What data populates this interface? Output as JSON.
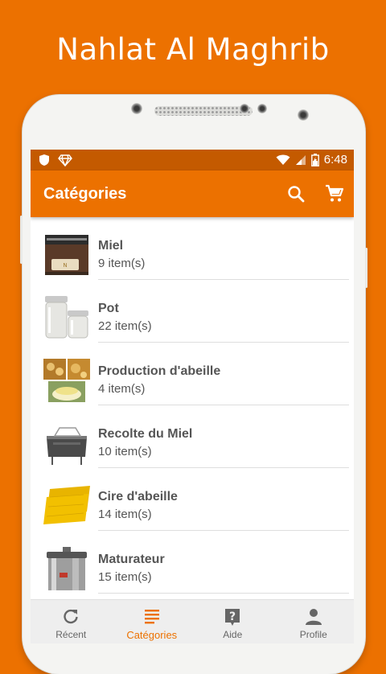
{
  "promo": {
    "title": "Nahlat Al Maghrib"
  },
  "status_bar": {
    "time": "6:48",
    "icons": [
      "shield-icon",
      "diamond-icon",
      "wifi-icon",
      "signal-icon",
      "battery-icon"
    ]
  },
  "app_bar": {
    "title": "Catégories",
    "actions": [
      "search-icon",
      "cart-icon"
    ]
  },
  "categories": [
    {
      "name": "Miel",
      "count": "9 item(s)"
    },
    {
      "name": "Pot",
      "count": "22 item(s)"
    },
    {
      "name": "Production d'abeille",
      "count": "4 item(s)"
    },
    {
      "name": "Recolte du Miel",
      "count": "10 item(s)"
    },
    {
      "name": "Cire d'abeille",
      "count": "14 item(s)"
    },
    {
      "name": "Maturateur",
      "count": "15 item(s)"
    }
  ],
  "bottom_nav": [
    {
      "label": "Récent",
      "icon": "refresh-icon",
      "active": false
    },
    {
      "label": "Catégories",
      "icon": "list-icon",
      "active": true
    },
    {
      "label": "Aide",
      "icon": "help-icon",
      "active": false
    },
    {
      "label": "Profile",
      "icon": "person-icon",
      "active": false
    }
  ],
  "colors": {
    "accent": "#ec7100",
    "status_bar": "#c45a00"
  }
}
